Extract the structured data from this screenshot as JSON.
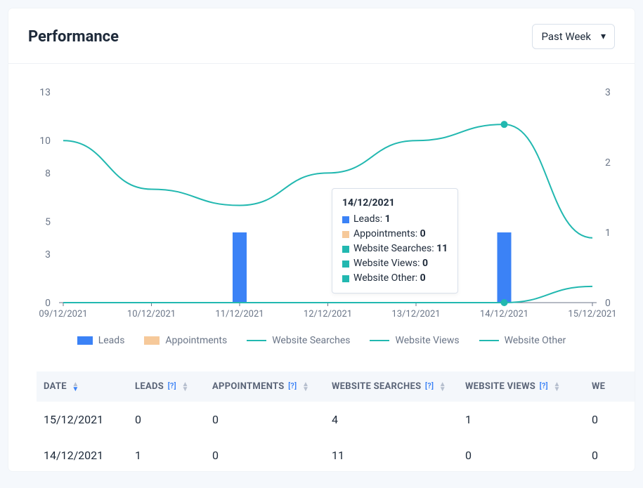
{
  "header": {
    "title": "Performance",
    "dropdown": {
      "selected": "Past Week"
    }
  },
  "chart_data": {
    "type": "bar",
    "categories": [
      "09/12/2021",
      "10/12/2021",
      "11/12/2021",
      "12/12/2021",
      "13/12/2021",
      "14/12/2021",
      "15/12/2021"
    ],
    "series": [
      {
        "name": "Leads",
        "type": "bar",
        "axis": "right",
        "values": [
          0,
          0,
          1,
          0,
          0,
          1,
          0
        ]
      },
      {
        "name": "Appointments",
        "type": "bar",
        "axis": "right",
        "values": [
          0,
          0,
          0,
          0,
          0,
          0,
          0
        ]
      },
      {
        "name": "Website Searches",
        "type": "line",
        "axis": "left",
        "values": [
          10,
          7,
          6,
          8,
          10,
          11,
          4
        ]
      },
      {
        "name": "Website Views",
        "type": "line",
        "axis": "left",
        "values": [
          0,
          0,
          0,
          0,
          0,
          0,
          1
        ]
      },
      {
        "name": "Website Other",
        "type": "line",
        "axis": "left",
        "values": [
          0,
          0,
          0,
          0,
          0,
          0,
          0
        ]
      }
    ],
    "y_left": {
      "ticks": [
        0,
        3,
        5,
        8,
        10,
        13
      ],
      "lim": [
        0,
        13
      ]
    },
    "y_right": {
      "ticks": [
        0,
        1,
        2,
        3
      ],
      "lim": [
        0,
        3
      ]
    },
    "legend": [
      "Leads",
      "Appointments",
      "Website Searches",
      "Website Views",
      "Website Other"
    ],
    "tooltip": {
      "date": "14/12/2021",
      "rows": [
        {
          "swatch": "blue",
          "label": "Leads",
          "value": "1"
        },
        {
          "swatch": "peach",
          "label": "Appointments",
          "value": "0"
        },
        {
          "swatch": "teal",
          "label": "Website Searches",
          "value": "11"
        },
        {
          "swatch": "teal",
          "label": "Website Views",
          "value": "0"
        },
        {
          "swatch": "teal",
          "label": "Website Other",
          "value": "0"
        }
      ]
    },
    "colors": {
      "bar_leads": "#3b82f6",
      "bar_appt": "#f6c99a",
      "line": "#22b8b0"
    }
  },
  "table": {
    "columns": [
      {
        "label": "DATE"
      },
      {
        "label": "LEADS",
        "help": true
      },
      {
        "label": "APPOINTMENTS",
        "help": true
      },
      {
        "label": "WEBSITE SEARCHES",
        "help": true
      },
      {
        "label": "WEBSITE VIEWS",
        "help": true
      },
      {
        "label": "WEBSITE OTHER",
        "help": true
      }
    ],
    "col_cut_label": "WE",
    "rows": [
      {
        "date": "15/12/2021",
        "leads": "0",
        "appt": "0",
        "search": "4",
        "views": "1",
        "other": "0"
      },
      {
        "date": "14/12/2021",
        "leads": "1",
        "appt": "0",
        "search": "11",
        "views": "0",
        "other": "0"
      }
    ]
  }
}
